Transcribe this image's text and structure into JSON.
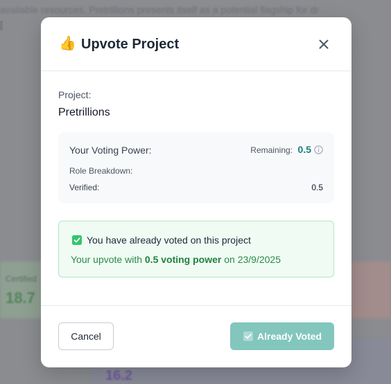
{
  "background": {
    "text": "available resources. Pretrillions presents itself as a potential flagship for dr",
    "stat_label": "Certified",
    "stat_green_value": "18.7",
    "stat_purple_value": "16.2"
  },
  "modal": {
    "emoji": "👍",
    "title": "Upvote Project",
    "close_icon": "close-icon",
    "project_label": "Project:",
    "project_name": "Pretrillions",
    "voting_power": {
      "label": "Your Voting Power:",
      "remaining_label": "Remaining:",
      "remaining_value": "0.5",
      "role_breakdown_label": "Role Breakdown:",
      "verified_label": "Verified:",
      "verified_value": "0.5"
    },
    "voted_notice": {
      "icon": "checkbox-checked-icon",
      "title": "You have already voted on this project",
      "prefix": "Your upvote with ",
      "power_text": "0.5 voting power",
      "suffix": " on 23/9/2025"
    },
    "buttons": {
      "cancel": "Cancel",
      "already_voted": "Already Voted"
    }
  },
  "colors": {
    "accent_teal": "#1a7f7a",
    "voted_button_bg": "#82c6bd",
    "success_green": "#2a8a4a",
    "success_bg": "#effbf3",
    "checkbox_green": "#34c46a"
  }
}
